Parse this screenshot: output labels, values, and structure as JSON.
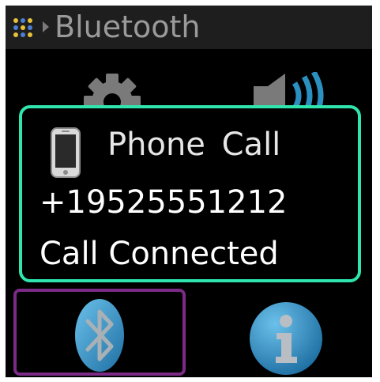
{
  "header": {
    "title": "Bluetooth",
    "menu_icon": "grid-dots-icon",
    "separator_icon": "breadcrumb-arrow-icon"
  },
  "toolbar": {
    "settings_icon": "gear-icon",
    "volume_icon": "speaker-volume-icon"
  },
  "call_dialog": {
    "icon": "mobile-phone-icon",
    "title": "Phone Call",
    "number": "+19525551212",
    "status": "Call Connected",
    "border_color": "#2fe5ad"
  },
  "bottom_bar": {
    "bluetooth_icon": "bluetooth-icon",
    "info_icon": "info-icon",
    "selected_border_color": "#7b2b86"
  },
  "colors": {
    "background": "#000000",
    "title_bar": "#1e1e1e",
    "title_text": "#9a9a9a",
    "icon_blue": "#2b8fc0"
  }
}
